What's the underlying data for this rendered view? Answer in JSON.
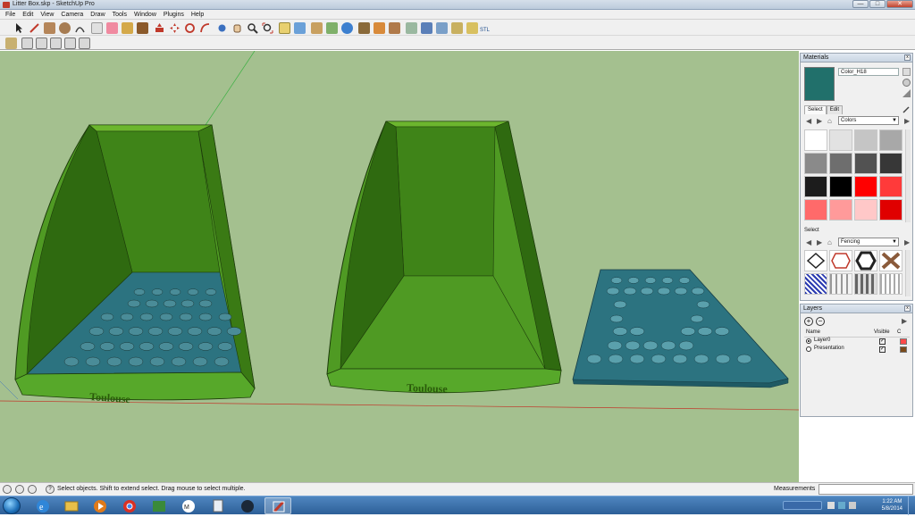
{
  "window": {
    "title": "Litter Box.skp - SketchUp Pro",
    "minimize": "—",
    "maximize": "□",
    "close": "✕"
  },
  "menu": [
    "File",
    "Edit",
    "View",
    "Camera",
    "Draw",
    "Tools",
    "Window",
    "Plugins",
    "Help"
  ],
  "model": {
    "left_label": "Toulouse",
    "middle_label": "Toulouse"
  },
  "materials": {
    "panel_title": "Materials",
    "current_name": "Color_H18",
    "current_color": "#21706b",
    "tab_select": "Select",
    "tab_edit": "Edit",
    "collection_1": "Colors",
    "swatches": [
      "#ffffff",
      "#e2e2e2",
      "#c5c5c5",
      "#a8a8a8",
      "#8a8a8a",
      "#6e6e6e",
      "#525252",
      "#373737",
      "#1c1c1c",
      "#000000",
      "#ff0000",
      "#ff3a3a",
      "#ff6a6a",
      "#ff9a9a",
      "#ffc8c8",
      "#e00000"
    ],
    "section_select": "Select",
    "collection_2": "Fencing"
  },
  "layers": {
    "panel_title": "Layers",
    "col_name": "Name",
    "col_visible": "Visible",
    "col_color": "C",
    "rows": [
      {
        "name": "Layer0",
        "active": true,
        "visible": true,
        "color": "#ff4a4a"
      },
      {
        "name": "Presentation",
        "active": false,
        "visible": true,
        "color": "#7a4a1a"
      }
    ]
  },
  "status": {
    "message": "Select objects. Shift to extend select. Drag mouse to select multiple.",
    "measurements_label": "Measurements"
  },
  "taskbar": {
    "time": "1:22 AM",
    "date": "5/8/2014"
  }
}
